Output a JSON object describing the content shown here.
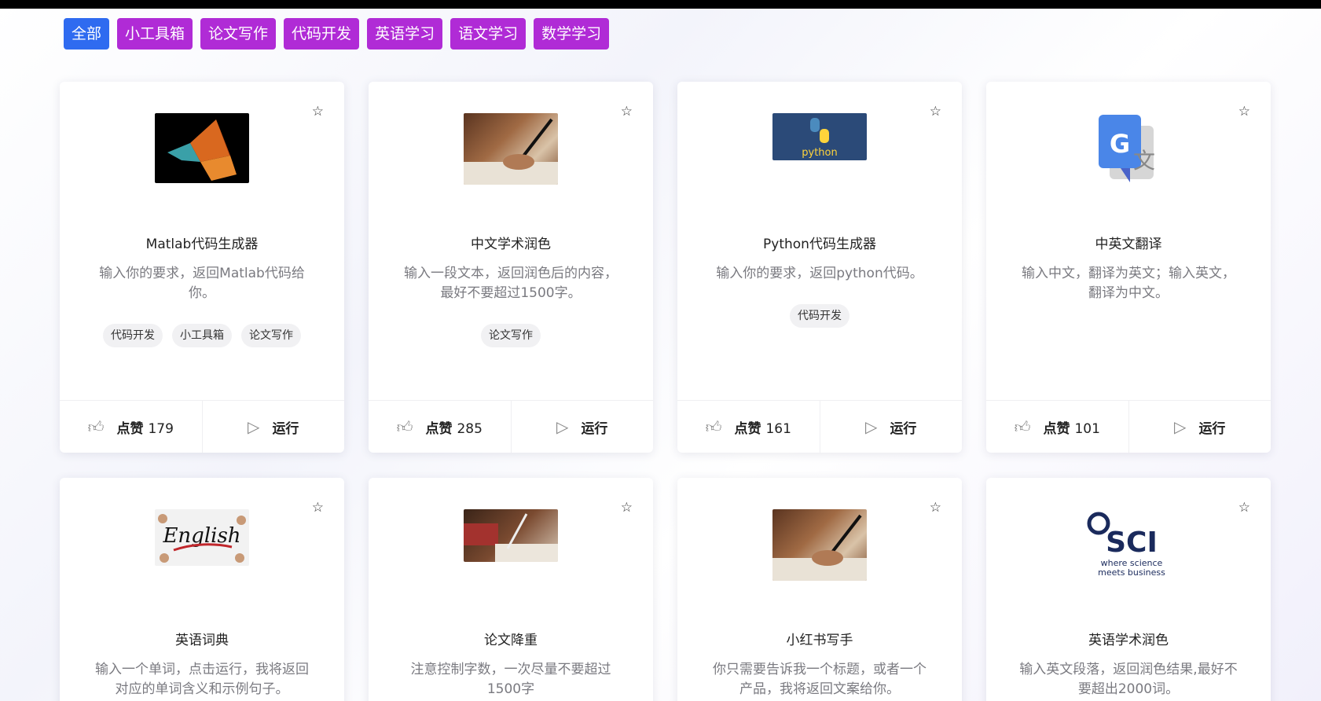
{
  "filters": [
    "全部",
    "小工具箱",
    "论文写作",
    "代码开发",
    "英语学习",
    "语文学习",
    "数学学习"
  ],
  "labels": {
    "like": "点赞",
    "run": "运行"
  },
  "cards": [
    {
      "title": "Matlab代码生成器",
      "desc": "输入你的要求，返回Matlab代码给你。",
      "tags": [
        "代码开发",
        "小工具箱",
        "论文写作"
      ],
      "likes": 179,
      "thumb": "matlab-logo"
    },
    {
      "title": "中文学术润色",
      "desc": "输入一段文本，返回润色后的内容，最好不要超过1500字。",
      "tags": [
        "论文写作"
      ],
      "likes": 285,
      "thumb": "writing-photo"
    },
    {
      "title": "Python代码生成器",
      "desc": "输入你的要求，返回python代码。",
      "tags": [
        "代码开发"
      ],
      "likes": 161,
      "thumb": "python-logo"
    },
    {
      "title": "中英文翻译",
      "desc": "输入中文，翻译为英文；输入英文，翻译为中文。",
      "tags": [],
      "likes": 101,
      "thumb": "google-translate-logo"
    },
    {
      "title": "英语词典",
      "desc": "输入一个单词，点击运行，我将返回对应的单词含义和示例句子。",
      "tags": [],
      "likes": null,
      "thumb": "english-photo"
    },
    {
      "title": "论文降重",
      "desc": "注意控制字数，一次尽量不要超过1500字",
      "tags": [],
      "likes": null,
      "thumb": "writing-photo"
    },
    {
      "title": "小红书写手",
      "desc": "你只需要告诉我一个标题，或者一个产品，我将返回文案给你。",
      "tags": [],
      "likes": null,
      "thumb": "writing-photo"
    },
    {
      "title": "英语学术润色",
      "desc": "输入英文段落，返回润色结果,最好不要超出2000词。",
      "tags": [],
      "likes": null,
      "thumb": "sci-logo"
    }
  ],
  "sci_logo": {
    "brand": "SCI",
    "slogan_1": "where science",
    "slogan_2": "meets business"
  },
  "python_logo": {
    "text": "python"
  }
}
